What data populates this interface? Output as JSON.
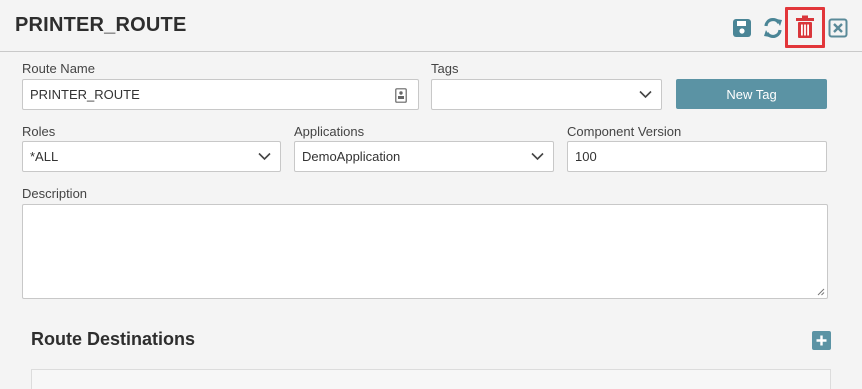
{
  "header": {
    "title": "PRINTER_ROUTE",
    "actions": [
      {
        "name": "save-icon",
        "color": "#4a8596"
      },
      {
        "name": "refresh-icon",
        "color": "#4a8596"
      },
      {
        "name": "trash-icon",
        "color": "#d9363b"
      },
      {
        "name": "close-icon",
        "color": "#5a8a99"
      }
    ]
  },
  "form": {
    "route_name": {
      "label": "Route Name",
      "value": "PRINTER_ROUTE"
    },
    "tags": {
      "label": "Tags",
      "value": ""
    },
    "new_tag_button": "New Tag",
    "roles": {
      "label": "Roles",
      "value": "*ALL"
    },
    "applications": {
      "label": "Applications",
      "value": "DemoApplication"
    },
    "component_version": {
      "label": "Component Version",
      "value": "100"
    },
    "description": {
      "label": "Description",
      "value": ""
    }
  },
  "route_destinations": {
    "title": "Route Destinations"
  },
  "colors": {
    "accent": "#5b93a4",
    "highlight": "#e2363a",
    "background": "#f4f4f4"
  }
}
